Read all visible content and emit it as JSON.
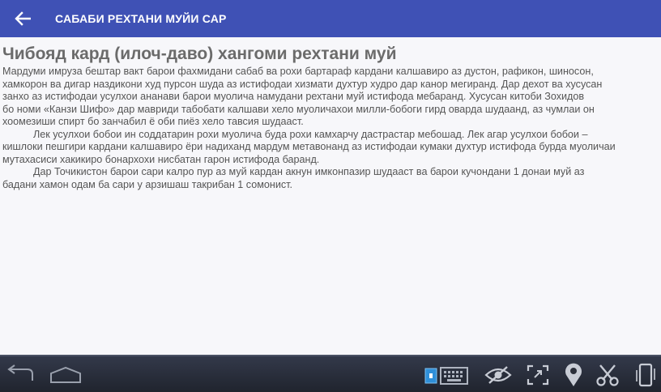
{
  "toolbar": {
    "title": "САБАБИ РЕХТАНИ МУЙИ САР"
  },
  "article": {
    "title": "Чибояд кард (илоч-даво) хангоми рехтани муй",
    "lines": [
      "Мардуми имруза бештар вакт барои фахмидани сабаб ва рохи бартараф кардани калшавиро аз дустон, рафикон, шиносон,",
      "хамкорон ва дигар наздикони худ пурсон шуда аз истифодаи хизмати духтур худро дар канор мегиранд. Дар дехот ва хусусан",
      "занхо аз истифодаи усулхои ананави барои муолича намудани рехтани муй истифода мебаранд. Хусусан китоби Зохидов",
      "бо номи «Канзи Шифо» дар мавриди табобати калшави хело муоличахои милли-бобоги гирд оварда шудаанд, аз чумлаи он",
      "хоомезиши спирт бо занчабил ё оби пиёз хело тавсия шудааст."
    ],
    "lines2": [
      "Лек усулхои бобои ин соддатарин рохи муолича буда рохи камхарчу дастрастар мебошад. Лек агар усулхои бобои –",
      "кишлоки пешгири кардани калшавиро ёри надиханд мардум метавонанд аз истифодаи кумаки духтур истифода бурда муоличаи",
      "мутахасиси хакикиро бонархохи нисбатан гарон истифода баранд."
    ],
    "lines3": [
      "Дар Точикистон барои сари калро пур аз муй кардан акнун  имконпазир шудааст ва барои кучондани  1 донаи муй аз",
      "бадани хамон одам ба сари у арзишаш такрибан 1 сомонист."
    ]
  },
  "icons": {
    "back": "arrow-left-icon",
    "nav_back": "nav-back-icon",
    "nav_home": "nav-home-icon",
    "keyboard": "keyboard-icon",
    "eye": "eye-off-icon",
    "expand": "fullscreen-icon",
    "location": "location-pin-icon",
    "scissors": "scissors-icon",
    "rotate": "screen-rotate-icon"
  },
  "colors": {
    "toolbar": "#3f51b5",
    "background": "#f7f7fa",
    "navbar": "#2b2f3a",
    "keyboard_accent": "#2f8fd8"
  }
}
